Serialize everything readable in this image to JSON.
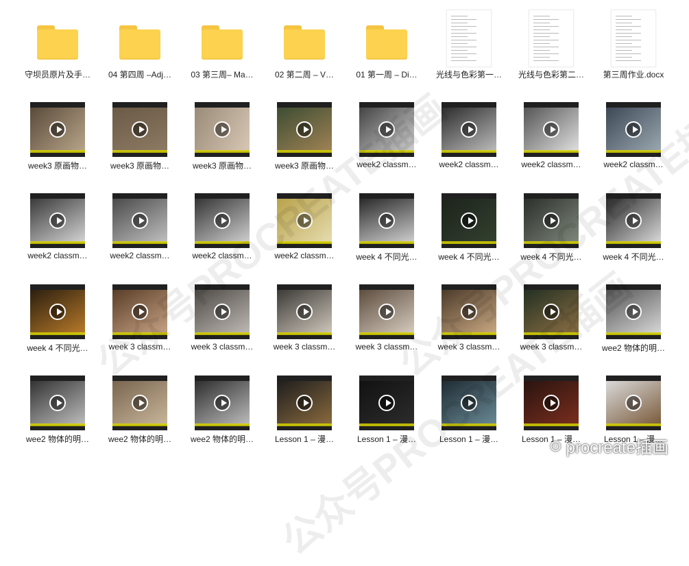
{
  "items": [
    {
      "label": "守坝员原片及手…",
      "type": "folder"
    },
    {
      "label": "04 第四周 –Adj…",
      "type": "folder"
    },
    {
      "label": "03 第三周– Ma…",
      "type": "folder"
    },
    {
      "label": "02 第二周 – V…",
      "type": "folder"
    },
    {
      "label": "01 第一周 – Di…",
      "type": "folder"
    },
    {
      "label": "光线与色彩第一…",
      "type": "document"
    },
    {
      "label": "光线与色彩第二…",
      "type": "document"
    },
    {
      "label": "第三周作业.docx",
      "type": "document"
    },
    {
      "label": "week3 原画物…",
      "type": "video"
    },
    {
      "label": "week3 原画物…",
      "type": "video"
    },
    {
      "label": "week3 原画物…",
      "type": "video"
    },
    {
      "label": "week3 原画物…",
      "type": "video"
    },
    {
      "label": "week2 classm…",
      "type": "video"
    },
    {
      "label": "week2 classm…",
      "type": "video"
    },
    {
      "label": "week2 classm…",
      "type": "video"
    },
    {
      "label": "week2 classm…",
      "type": "video"
    },
    {
      "label": "week2 classm…",
      "type": "video"
    },
    {
      "label": "week2 classm…",
      "type": "video"
    },
    {
      "label": "week2 classm…",
      "type": "video"
    },
    {
      "label": "week2 classm…",
      "type": "video"
    },
    {
      "label": "week 4 不同光…",
      "type": "video"
    },
    {
      "label": "week 4 不同光…",
      "type": "video"
    },
    {
      "label": "week 4 不同光…",
      "type": "video"
    },
    {
      "label": "week 4 不同光…",
      "type": "video"
    },
    {
      "label": "week 4 不同光…",
      "type": "video"
    },
    {
      "label": "week 3 classm…",
      "type": "video"
    },
    {
      "label": "week 3 classm…",
      "type": "video"
    },
    {
      "label": "week 3 classm…",
      "type": "video"
    },
    {
      "label": "week 3 classm…",
      "type": "video"
    },
    {
      "label": "week 3 classm…",
      "type": "video"
    },
    {
      "label": "week 3 classm…",
      "type": "video"
    },
    {
      "label": "wee2 物体的明…",
      "type": "video"
    },
    {
      "label": "wee2 物体的明…",
      "type": "video"
    },
    {
      "label": "wee2 物体的明…",
      "type": "video"
    },
    {
      "label": "wee2 物体的明…",
      "type": "video"
    },
    {
      "label": "Lesson 1 – 漫…",
      "type": "video"
    },
    {
      "label": "Lesson 1 – 漫…",
      "type": "video"
    },
    {
      "label": "Lesson 1 – 漫…",
      "type": "video"
    },
    {
      "label": "Lesson 1 – 漫…",
      "type": "video"
    },
    {
      "label": "Lesson 1 – 漫…",
      "type": "video"
    }
  ],
  "colors": {
    "folder": "#fcd24f",
    "folder_tab": "#f5c542",
    "thumb_dark": "#202020",
    "subtitle_bar": "#d7d200"
  },
  "watermark": {
    "lines": [
      "公众号PROCREATE插画",
      "公众号PROCREATE插画",
      "公众号PROCREATE插画"
    ],
    "brand": "procreate插画",
    "brand_icon": "wechat-icon"
  }
}
